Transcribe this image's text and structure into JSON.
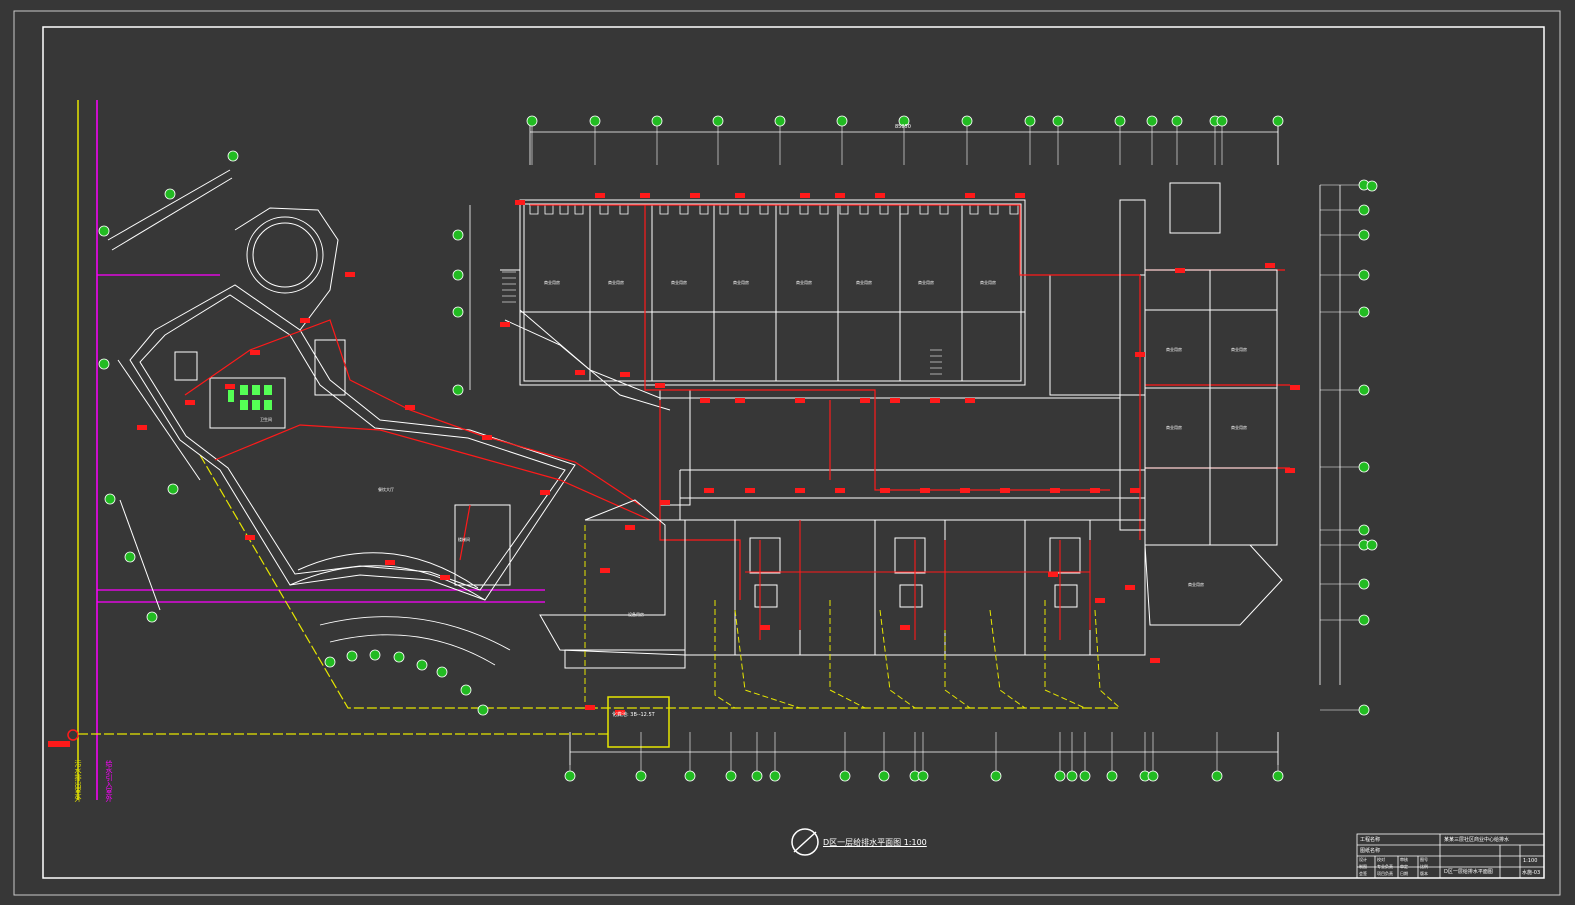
{
  "drawing": {
    "caption": "D区一层给排水平面图 1:100",
    "riser_labels": {
      "left_yellow": "污水排出室外",
      "left_magenta": "给水引入室外"
    },
    "sump_label": "化粪池: 3B--12.5T",
    "dimension_total": "85850"
  },
  "title_block": {
    "project_label": "工程名称",
    "project_value": "某某三层社区商业中心给排水",
    "drawing_label": "图纸名称",
    "drawing_value": "D区一层给排水平面图",
    "rows": [
      [
        "设计",
        "校对",
        "审核",
        "图号"
      ],
      [
        "制图",
        "专业负责",
        "审定",
        "比例"
      ],
      [
        "会签",
        "项目负责",
        "日期",
        "版本"
      ]
    ],
    "scale": "1:100",
    "sheet": "水施-03"
  },
  "rooms": [
    "商业用房",
    "商业用房",
    "商业用房",
    "商业用房",
    "商业用房",
    "商业用房",
    "商业用房",
    "商业用房",
    "餐饮大厅",
    "卫生间",
    "楼梯间",
    "设备用房",
    "商业用房",
    "商业用房",
    "商业用房",
    "商业用房",
    "商业用房"
  ],
  "colors": {
    "background": "#373737",
    "wall": "#ffffff",
    "cold_water": "#ff1a1a",
    "drain": "#e6e600",
    "magenta": "#ff00ff",
    "grid_bubble": "#22bb22",
    "fixture_green": "#55ff55"
  }
}
